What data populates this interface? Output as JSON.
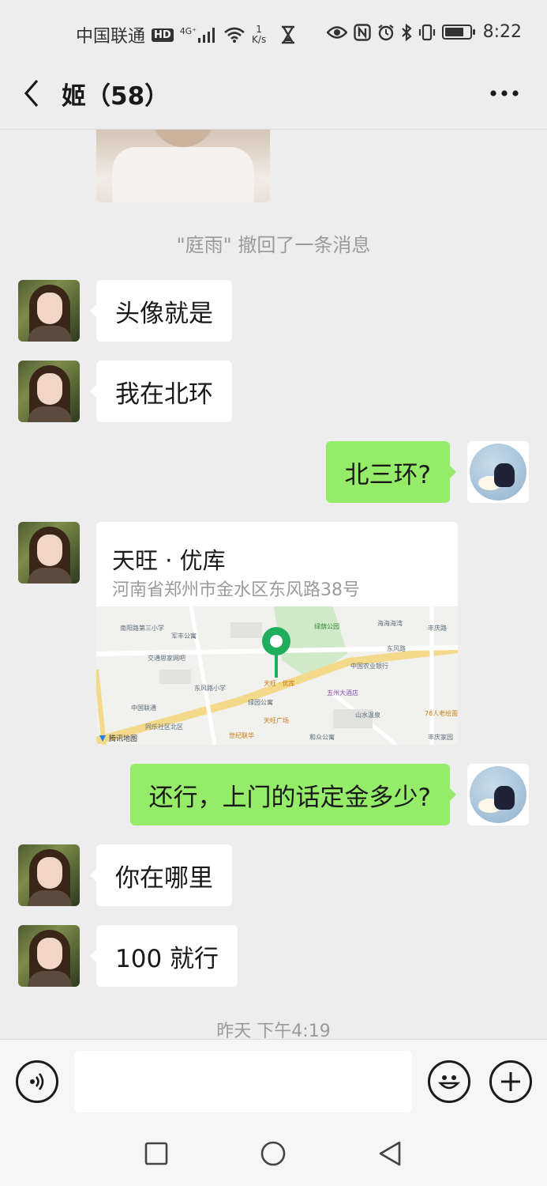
{
  "status_bar": {
    "carrier": "中国联通",
    "hd": "HD",
    "network": "4G⁺",
    "speed_value": "1",
    "speed_unit": "K/s",
    "time": "8:22",
    "battery_level": 0.75
  },
  "header": {
    "title": "姬（58）"
  },
  "chat": {
    "recall_notice": "\"庭雨\" 撤回了一条消息",
    "messages": [
      {
        "side": "left",
        "text": "头像就是"
      },
      {
        "side": "left",
        "text": "我在北环"
      },
      {
        "side": "right",
        "text": "北三环?"
      },
      {
        "side": "right",
        "text": "还行，上门的话定金多少?"
      },
      {
        "side": "left",
        "text": "你在哪里"
      },
      {
        "side": "left",
        "text": "100 就行"
      }
    ],
    "location": {
      "name": "天旺 · 优库",
      "address": "河南省郑州市金水区东风路38号",
      "map_labels": [
        "南阳路第三小学",
        "军丰公寓",
        "交通思家网吧",
        "东风路小学",
        "天旺 · 优库",
        "绿园公寓",
        "天旺广场",
        "五州大酒店",
        "中国农业银行",
        "海海海湾",
        "东风路",
        "山水温泉",
        "和众公寓",
        "丰庆路",
        "中国联通",
        "同乐社区北区",
        "世纪联华",
        "76人老绘面",
        "丰庆家园",
        "绿荫公园"
      ],
      "map_brand": "腾讯地图"
    },
    "timestamp": "昨天 下午4:19"
  },
  "colors": {
    "background": "#ededed",
    "bubble_mine": "#95ec69",
    "bubble_theirs": "#ffffff",
    "pin": "#1fae5b"
  },
  "icons": {
    "back": "chevron-left-icon",
    "more": "more-dots-icon",
    "voice": "voice-icon",
    "emoji": "emoji-icon",
    "plus": "plus-icon"
  }
}
